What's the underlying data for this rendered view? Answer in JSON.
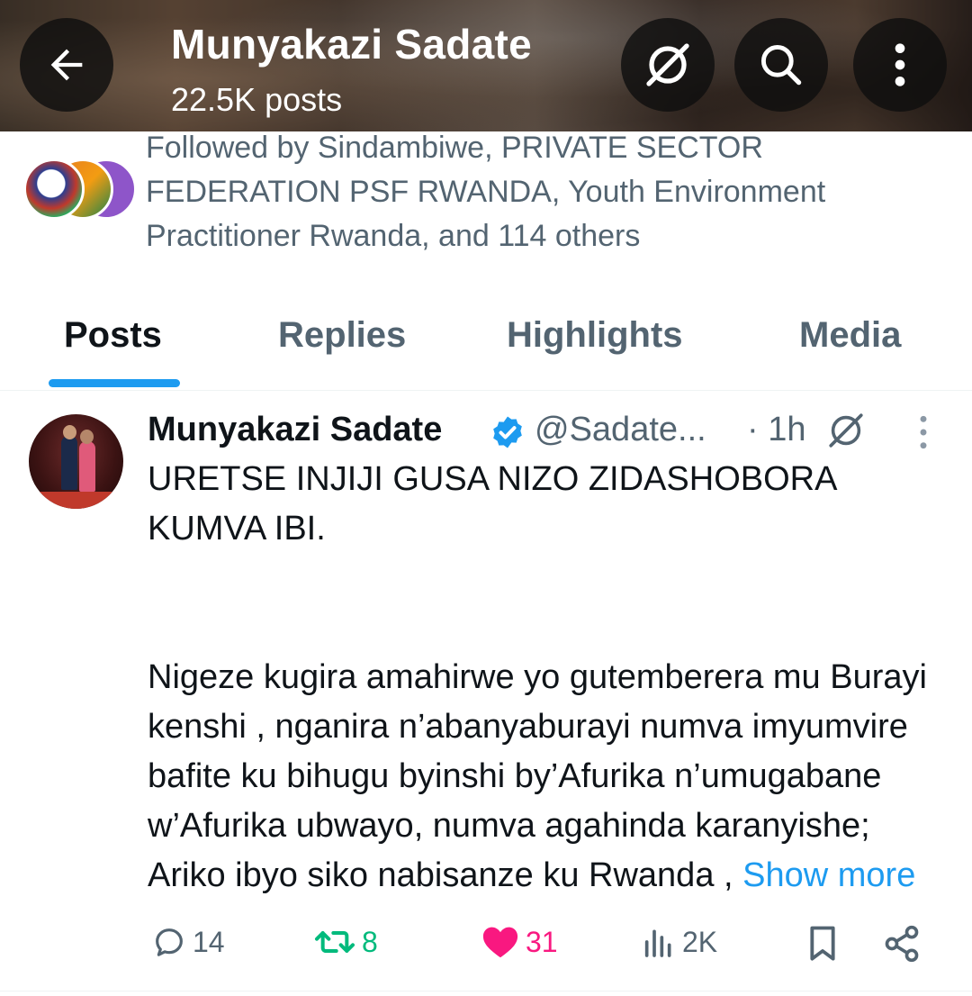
{
  "header": {
    "name": "Munyakazi Sadate",
    "post_count": "22.5K posts"
  },
  "followers": {
    "text": "Followed by Sindambiwe, PRIVATE SECTOR FEDERATION PSF RWANDA, Youth Environment Practitioner Rwanda, and 114 others"
  },
  "tabs": [
    {
      "label": "Posts",
      "active": true
    },
    {
      "label": "Replies",
      "active": false
    },
    {
      "label": "Highlights",
      "active": false
    },
    {
      "label": "Media",
      "active": false
    }
  ],
  "post": {
    "author_name": "Munyakazi Sadate",
    "handle": "@Sadate...",
    "time": "· 1h",
    "paragraph1": "URETSE INJIJI GUSA NIZO ZIDASHOBORA KUMVA IBI.",
    "paragraph2": "Nigeze kugira amahirwe yo gutemberera mu Burayi kenshi , nganira n’abanyaburayi numva imyumvire  bafite ku bihugu byinshi by’Afurika n’umugabane w’Afurika ubwayo,  numva agahinda karanyishe; Ariko ibyo siko nabisanze  ku Rwanda ,",
    "show_more": "Show more",
    "replies": "14",
    "reposts": "8",
    "likes": "31",
    "views": "2K"
  },
  "colors": {
    "accent": "#1d9bf0",
    "repost": "#00ba7c",
    "like": "#f91880",
    "muted": "#536471",
    "text": "#0f1419"
  },
  "icons": [
    "back-arrow-icon",
    "grok-icon",
    "search-icon",
    "more-vertical-icon",
    "verified-badge-icon",
    "reply-icon",
    "repost-icon",
    "like-icon",
    "views-icon",
    "bookmark-icon",
    "share-icon"
  ]
}
